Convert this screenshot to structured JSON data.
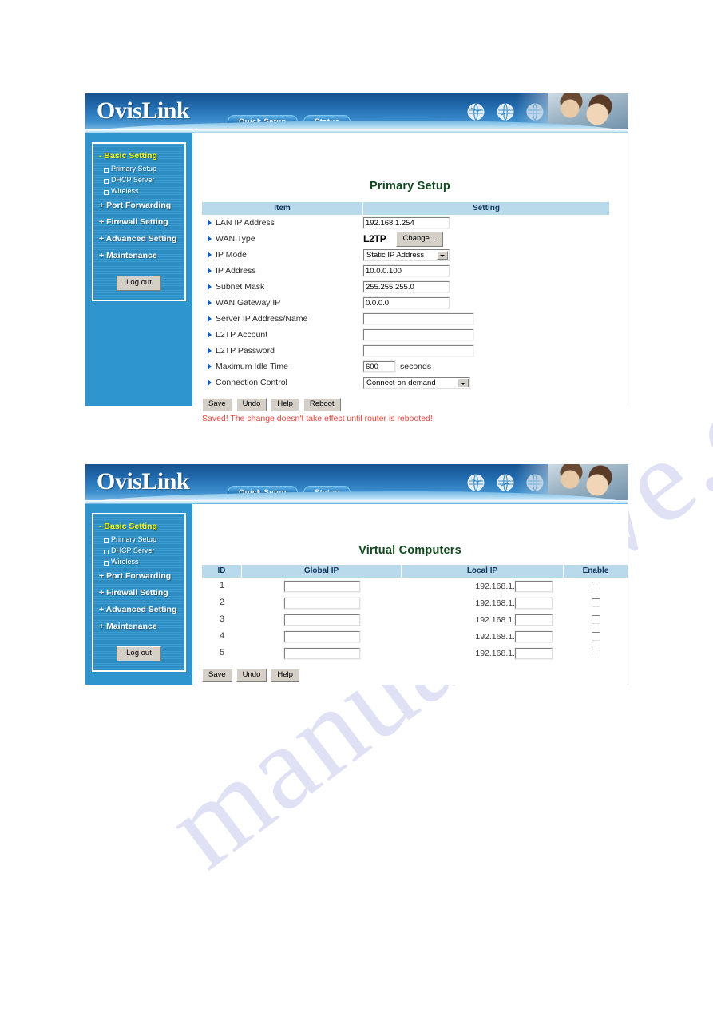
{
  "watermark": {
    "text": "manualshive.com"
  },
  "brand": {
    "logo": "OvisLink"
  },
  "nav": {
    "tabs": [
      "Quick Setup",
      "Status"
    ]
  },
  "icons": {
    "globes": [
      "globe-icon",
      "globe-icon",
      "globe-icon"
    ]
  },
  "sidebar": {
    "groups": [
      {
        "prefix": "-",
        "label": "Basic Setting",
        "active": true,
        "children": [
          "Primary Setup",
          "DHCP Server",
          "Wireless"
        ]
      },
      {
        "prefix": "+",
        "label": "Port Forwarding",
        "children": []
      },
      {
        "prefix": "+",
        "label": "Firewall Setting",
        "children": []
      },
      {
        "prefix": "+",
        "label": "Advanced Setting",
        "children": []
      },
      {
        "prefix": "+",
        "label": "Maintenance",
        "children": []
      }
    ],
    "logout_label": "Log out"
  },
  "primary_setup": {
    "title": "Primary Setup",
    "columns": {
      "item": "Item",
      "setting": "Setting"
    },
    "rows": [
      {
        "label": "LAN IP Address",
        "type": "text",
        "value": "192.168.1.254"
      },
      {
        "label": "WAN Type",
        "type": "wan",
        "value": "L2TP",
        "button": "Change..."
      },
      {
        "label": "IP Mode",
        "type": "select",
        "value": "Static IP Address"
      },
      {
        "label": "IP Address",
        "type": "text",
        "value": "10.0.0.100"
      },
      {
        "label": "Subnet Mask",
        "type": "text",
        "value": "255.255.255.0"
      },
      {
        "label": "WAN Gateway IP",
        "type": "text",
        "value": "0.0.0.0"
      },
      {
        "label": "Server IP Address/Name",
        "type": "wide",
        "value": ""
      },
      {
        "label": "L2TP Account",
        "type": "wide",
        "value": ""
      },
      {
        "label": "L2TP Password",
        "type": "wide",
        "value": ""
      },
      {
        "label": "Maximum Idle Time",
        "type": "number",
        "value": "600",
        "unit": "seconds"
      },
      {
        "label": "Connection Control",
        "type": "select2",
        "value": "Connect-on-demand"
      }
    ],
    "buttons": [
      "Save",
      "Undo",
      "Help",
      "Reboot"
    ],
    "message": "Saved! The change doesn't take effect until router is rebooted!",
    "message_color": "#e8463c"
  },
  "virtual_computers": {
    "title": "Virtual Computers",
    "columns": [
      "ID",
      "Global IP",
      "Local IP",
      "Enable"
    ],
    "local_ip_prefix": "192.168.1.",
    "rows": [
      {
        "id": "1",
        "global_ip": "",
        "local_ip": "",
        "enable": false
      },
      {
        "id": "2",
        "global_ip": "",
        "local_ip": "",
        "enable": false
      },
      {
        "id": "3",
        "global_ip": "",
        "local_ip": "",
        "enable": false
      },
      {
        "id": "4",
        "global_ip": "",
        "local_ip": "",
        "enable": false
      },
      {
        "id": "5",
        "global_ip": "",
        "local_ip": "",
        "enable": false
      }
    ],
    "buttons": [
      "Save",
      "Undo",
      "Help"
    ]
  }
}
